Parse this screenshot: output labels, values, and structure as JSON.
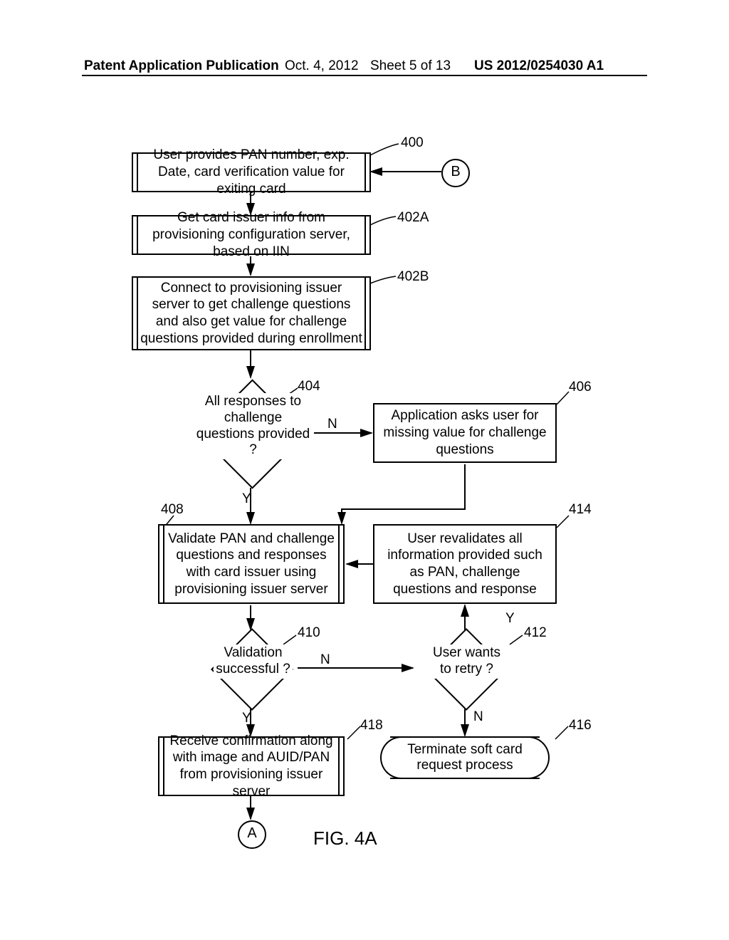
{
  "header": {
    "left": "Patent Application Publication",
    "date": "Oct. 4, 2012",
    "sheet": "Sheet 5 of 13",
    "pubno": "US 2012/0254030 A1"
  },
  "refs": {
    "r400": "400",
    "r402A": "402A",
    "r402B": "402B",
    "r404": "404",
    "r406": "406",
    "r408": "408",
    "r410": "410",
    "r412": "412",
    "r414": "414",
    "r416": "416",
    "r418": "418"
  },
  "nodes": {
    "B": "B",
    "A": "A",
    "n400": "User provides PAN number, exp. Date, card verification value for exiting card",
    "n402A": "Get card issuer info from provisioning configuration server, based on IIN",
    "n402B": "Connect to provisioning issuer server to get challenge questions and also get value for challenge questions provided during enrollment",
    "d404": "All responses to challenge questions provided ?",
    "n406": "Application asks user for missing value for challenge questions",
    "n408": "Validate PAN and challenge questions and responses with card issuer using provisioning issuer server",
    "d410": "Validation successful ?",
    "d412": "User wants to retry ?",
    "n414": "User revalidates all information provided such as PAN, challenge questions and response",
    "t416": "Terminate soft card request process",
    "n418": "Receive confirmation along with image and AUID/PAN from provisioning issuer server"
  },
  "labels": {
    "Y": "Y",
    "N": "N"
  },
  "figure": "FIG. 4A"
}
